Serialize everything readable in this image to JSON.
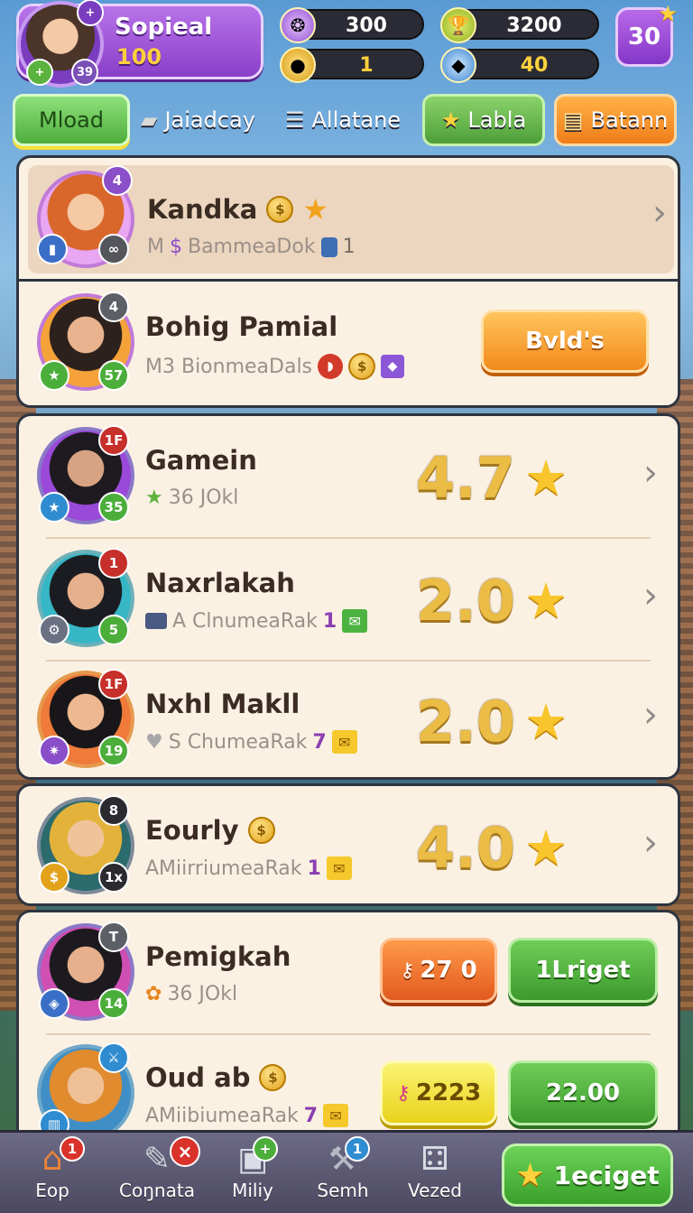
{
  "player": {
    "name": "Sopieal",
    "level": "100",
    "badge_left": "+",
    "badge_right": "39"
  },
  "resources": [
    {
      "icon": "purple-coin-icon",
      "value": "300"
    },
    {
      "icon": "gold-trophy-icon",
      "value": "3200"
    },
    {
      "icon": "gold-coin-icon",
      "value": "1"
    },
    {
      "icon": "blue-gem-icon",
      "value": "40"
    }
  ],
  "corner_box": {
    "value": "30"
  },
  "tabs": [
    {
      "label": "Mload",
      "active": true
    },
    {
      "label": "Jaiadcay"
    },
    {
      "label": "Allatane"
    },
    {
      "label": "Labla"
    },
    {
      "label": "Batann"
    }
  ],
  "rows": [
    {
      "name": "Kandka",
      "sub": "M",
      "sub2": "BammeaDok",
      "sub_count": "1",
      "badge_top": "4",
      "badge_br": "∞"
    },
    {
      "name": "Bohig Pamial",
      "sub": "M3 BionmeaDals",
      "badge_top": "4",
      "badge_br": "57",
      "button": "Bvld's"
    },
    {
      "name": "Gamein",
      "sub": "36 JOkl",
      "rating": "4.7",
      "badge_top": "1F",
      "badge_br": "35"
    },
    {
      "name": "Naxrlakah",
      "sub": "A ClnumeaRak",
      "sub_count": "1",
      "rating": "2.0",
      "badge_top": "1",
      "badge_br": "5"
    },
    {
      "name": "Nxhl Makll",
      "sub": "S ChumeaRak",
      "sub_count": "7",
      "rating": "2.0",
      "badge_top": "1F",
      "badge_br": "19"
    },
    {
      "name": "Eourly",
      "sub": "AMiirriumeaRak",
      "sub_count": "1",
      "rating": "4.0",
      "badge_top": "8",
      "badge_br": "1x"
    },
    {
      "name": "Pemigkah",
      "sub": "36 JOkl",
      "badge_top": "T",
      "badge_br": "14",
      "price": "27 0",
      "button": "1Lriget"
    },
    {
      "name": "Oud ab",
      "sub": "AMiibiumeaRak",
      "sub_count": "7",
      "price": "2223",
      "button": "22.00"
    }
  ],
  "nav": [
    {
      "label": "Eop",
      "badge": "1"
    },
    {
      "label": "Coŋnata",
      "badge": "×"
    },
    {
      "label": "Miliy",
      "badge": "+"
    },
    {
      "label": "Semh",
      "badge": "1"
    },
    {
      "label": "Vezed"
    }
  ],
  "nav_cta": {
    "label": "1eciget"
  }
}
